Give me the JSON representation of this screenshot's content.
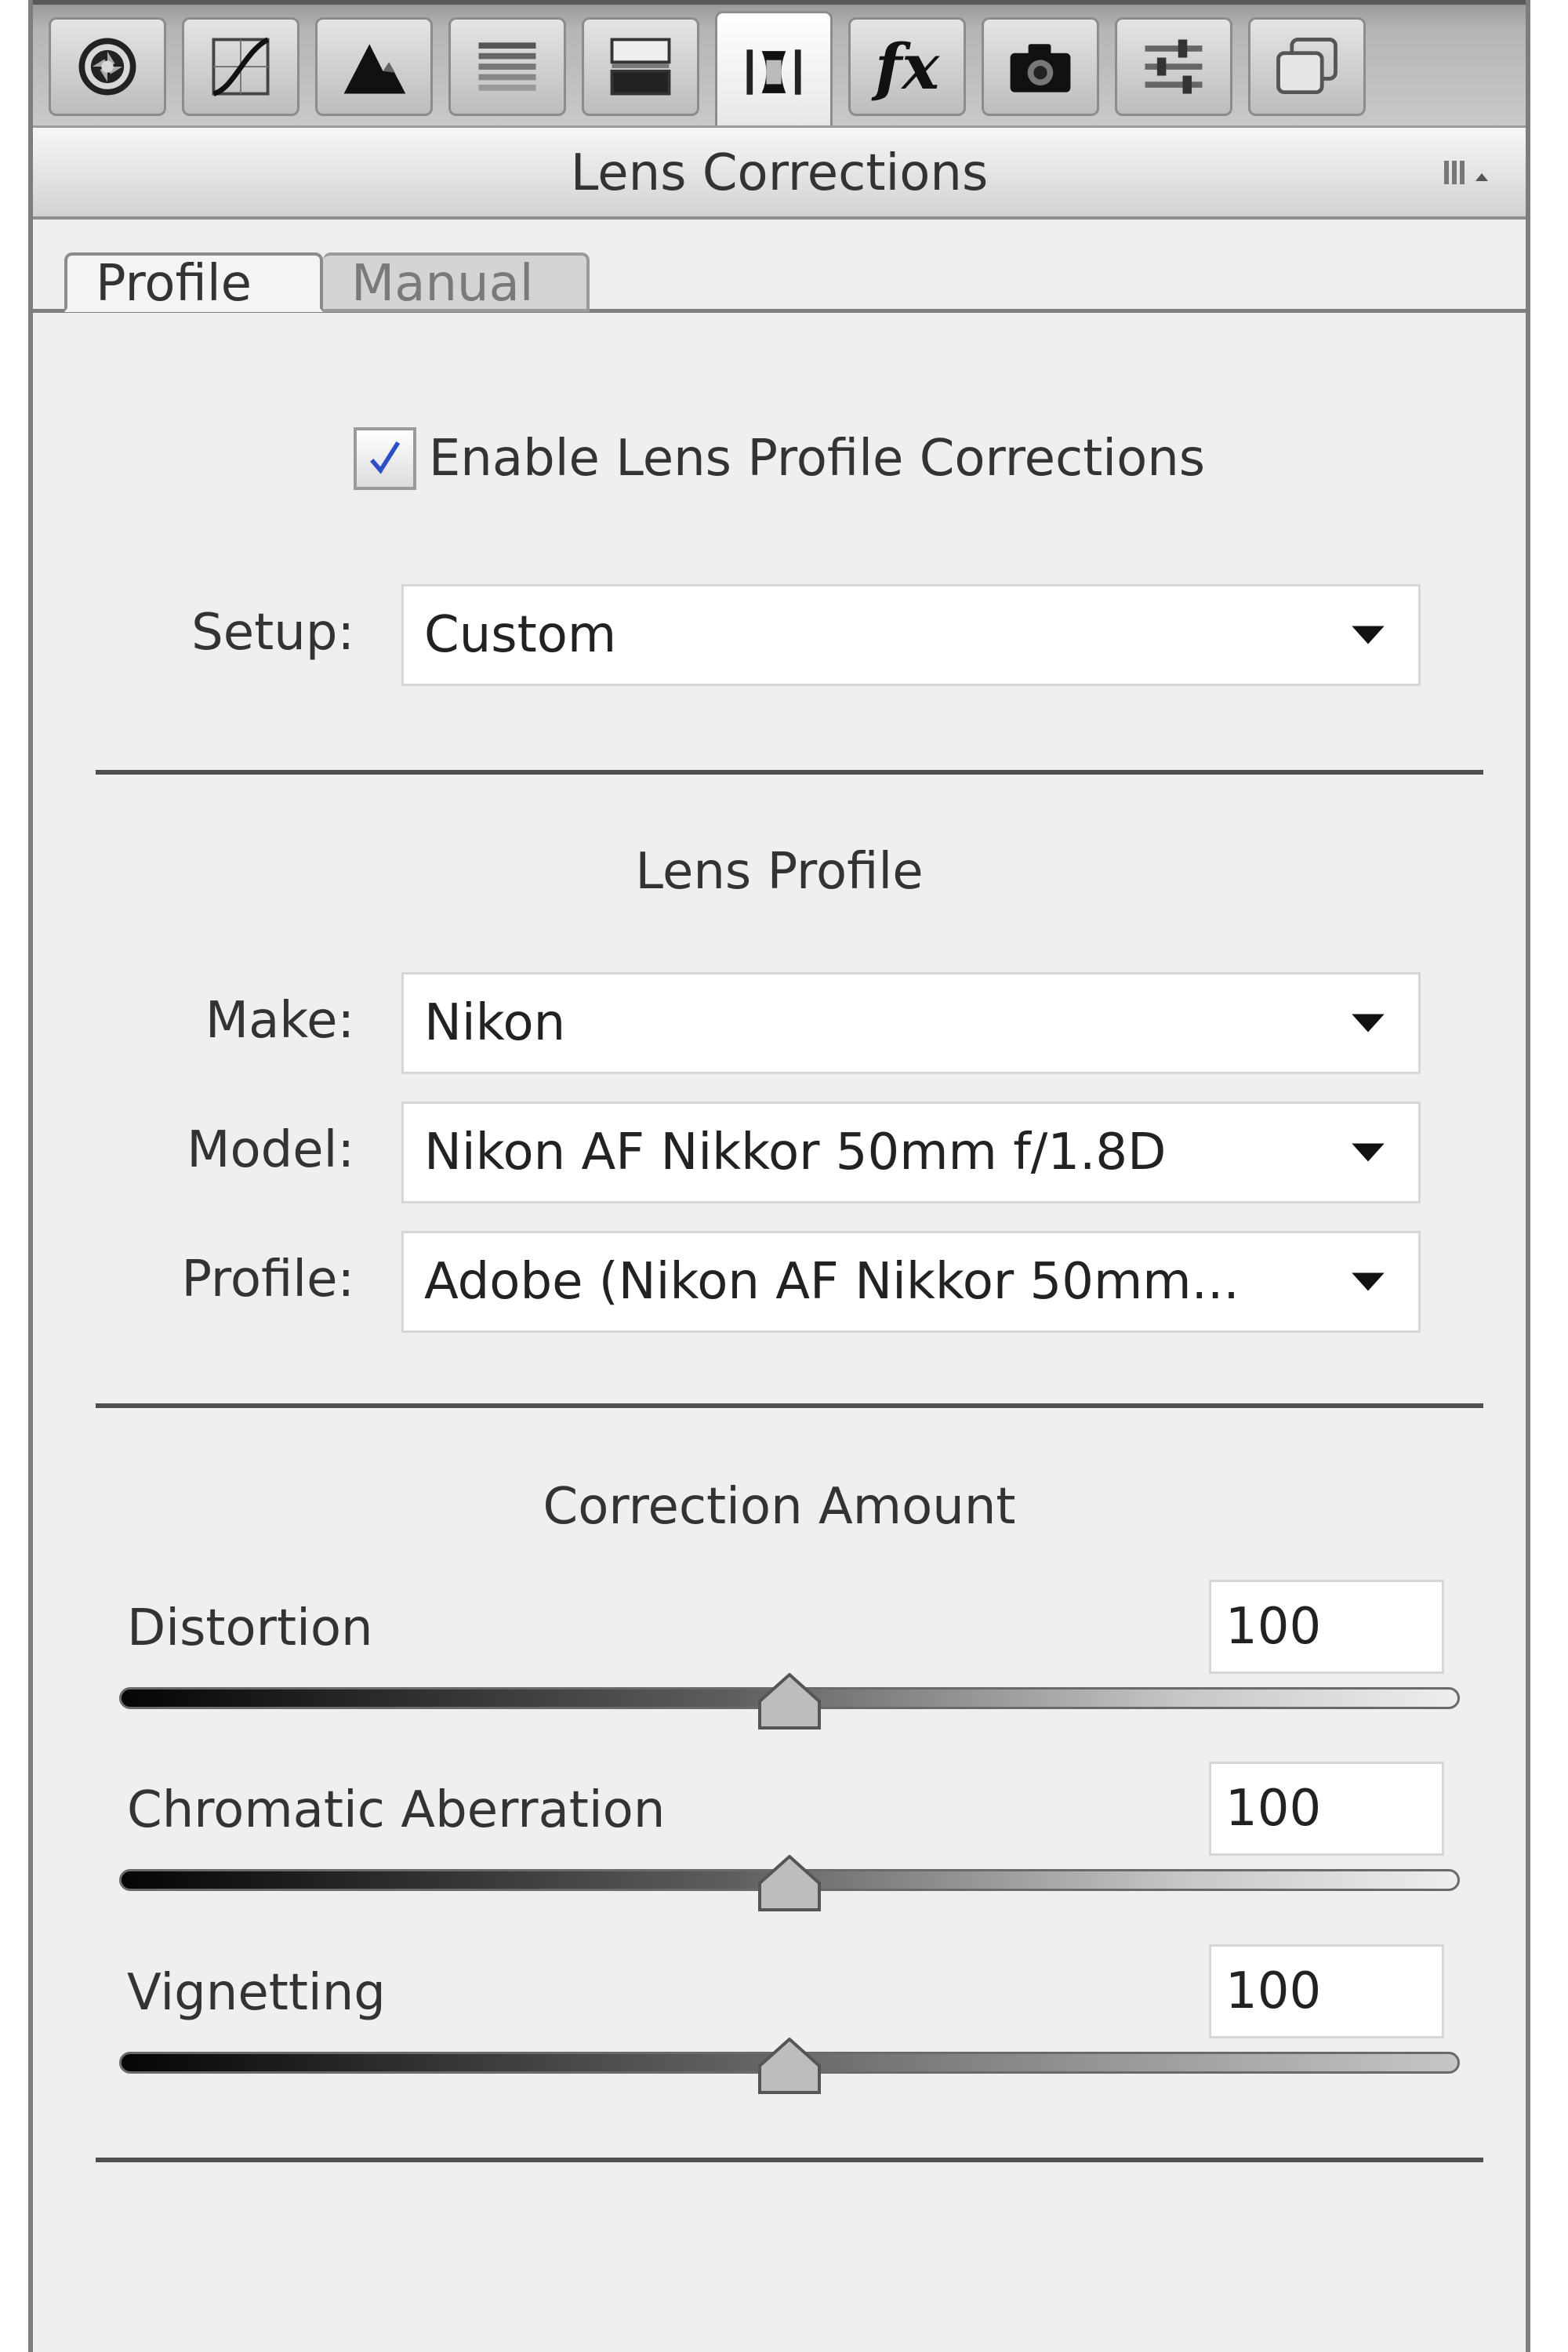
{
  "toolbar": {
    "tools": [
      {
        "name": "basic",
        "icon": "aperture-icon"
      },
      {
        "name": "tone-curve",
        "icon": "tone-curve-icon"
      },
      {
        "name": "detail",
        "icon": "detail-triangle-icon"
      },
      {
        "name": "hsl",
        "icon": "hsl-bars-icon"
      },
      {
        "name": "split-toning",
        "icon": "split-toning-icon"
      },
      {
        "name": "lens-corrections",
        "icon": "lens-icon",
        "active": true
      },
      {
        "name": "effects",
        "icon": "fx-icon",
        "glyph": "fx"
      },
      {
        "name": "camera-calibration",
        "icon": "camera-icon"
      },
      {
        "name": "presets",
        "icon": "presets-sliders-icon"
      },
      {
        "name": "snapshots",
        "icon": "snapshots-icon"
      }
    ]
  },
  "header": {
    "title": "Lens Corrections",
    "menu_icon": "panel-menu-icon"
  },
  "tabs": {
    "profile": "Profile",
    "manual": "Manual",
    "active": "Profile"
  },
  "profile": {
    "enable_label": "Enable Lens Profile Corrections",
    "enable_checked": true,
    "setup_label": "Setup:",
    "setup_value": "Custom",
    "lens_profile_title": "Lens Profile",
    "make_label": "Make:",
    "make_value": "Nikon",
    "model_label": "Model:",
    "model_value": "Nikon AF Nikkor 50mm f/1.8D",
    "profile_label": "Profile:",
    "profile_value": "Adobe (Nikon AF Nikkor 50mm..."
  },
  "correction": {
    "title": "Correction Amount",
    "sliders": [
      {
        "label": "Distortion",
        "value": "100",
        "fraction": 0.5
      },
      {
        "label": "Chromatic Aberration",
        "value": "100",
        "fraction": 0.5
      },
      {
        "label": "Vignetting",
        "value": "100",
        "fraction": 0.5
      }
    ]
  }
}
